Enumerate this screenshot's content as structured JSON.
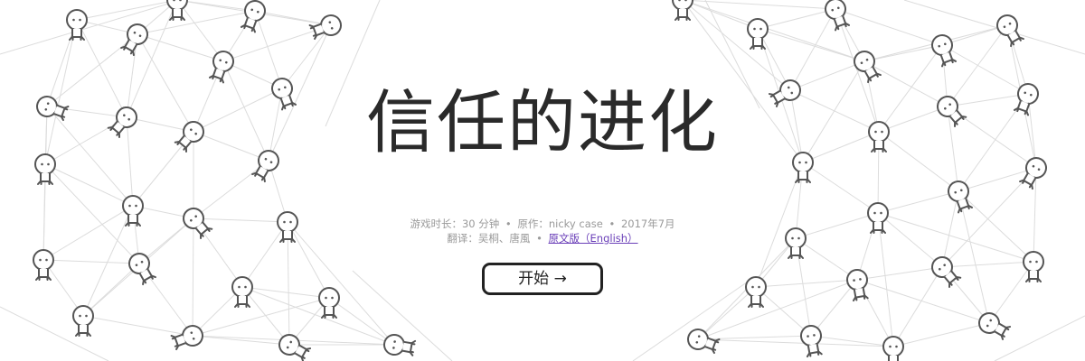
{
  "title": "信任的进化",
  "meta": {
    "playtime": "游戏时长：30 分钟",
    "author": "原作：nicky case",
    "date": "2017年7月",
    "bullet": "•",
    "translators": "翻译：吴桐、唐風",
    "original_link": "原文版（English）"
  },
  "start_button": "开始 →",
  "colors": {
    "character_stroke": "#555555",
    "line": "#dcdcdc",
    "link": "#6a3fb8"
  }
}
